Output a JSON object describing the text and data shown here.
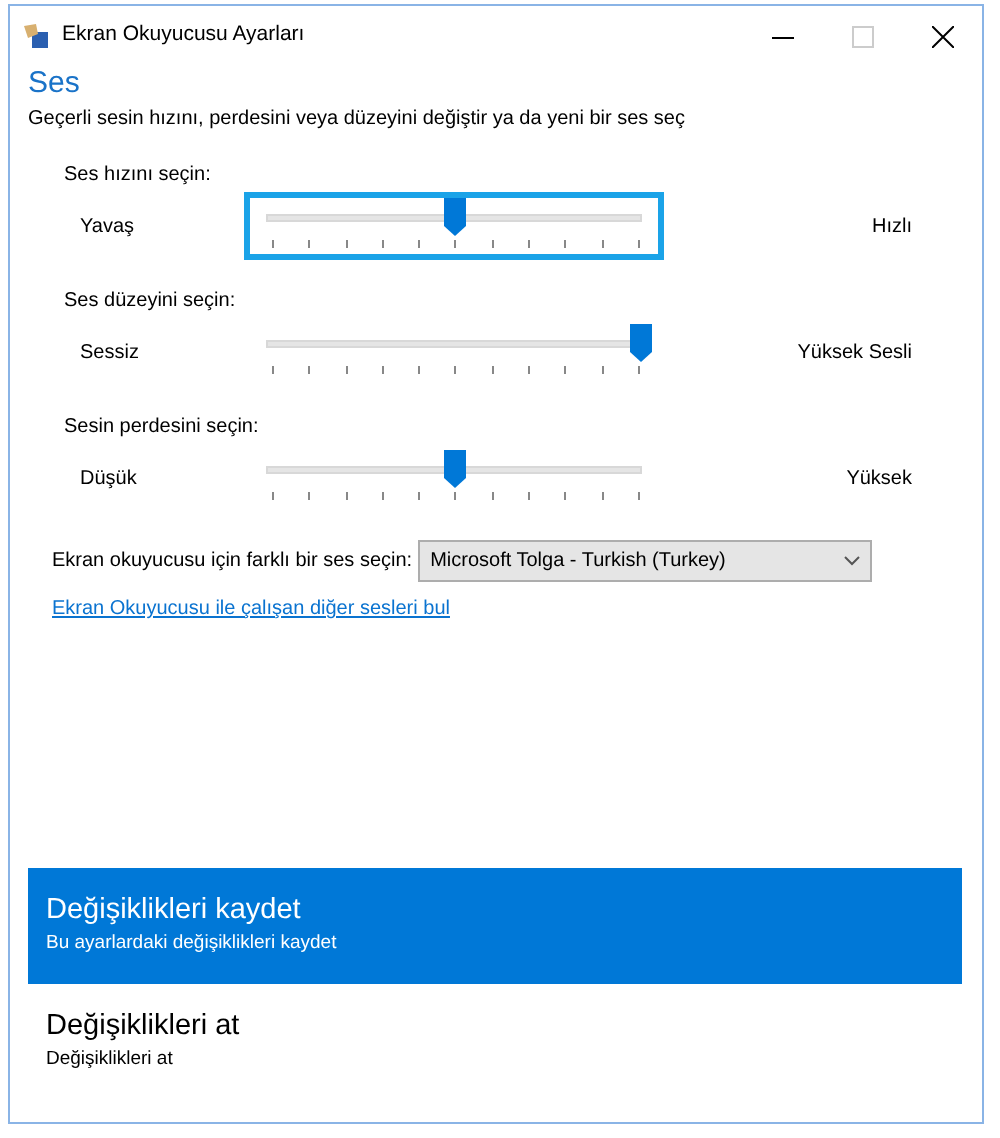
{
  "window": {
    "title": "Ekran Okuyucusu Ayarları"
  },
  "heading": "Ses",
  "description": "Geçerli sesin hızını, perdesini veya düzeyini değiştir ya da yeni bir ses seç",
  "sliders": [
    {
      "label": "Ses hızını seçin:",
      "min_label": "Yavaş",
      "max_label": "Hızlı",
      "level": 0.5,
      "focused": true
    },
    {
      "label": "Ses düzeyini seçin:",
      "min_label": "Sessiz",
      "max_label": "Yüksek Sesli",
      "level": 1,
      "focused": false
    },
    {
      "label": "Sesin perdesini seçin:",
      "min_label": "Düşük",
      "max_label": "Yüksek",
      "level": 0.5,
      "focused": false
    }
  ],
  "voice": {
    "label": "Ekran okuyucusu için farklı bir ses seçin:",
    "value": "Microsoft Tolga - Turkish (Turkey)"
  },
  "link": "Ekran Okuyucusu ile çalışan diğer sesleri bul",
  "commands": [
    {
      "title": "Değişiklikleri kaydet",
      "subtitle": "Bu ayarlardaki değişiklikleri kaydet",
      "selected": true
    },
    {
      "title": "Değişiklikleri at",
      "subtitle": "Değişiklikleri at",
      "selected": false
    }
  ]
}
